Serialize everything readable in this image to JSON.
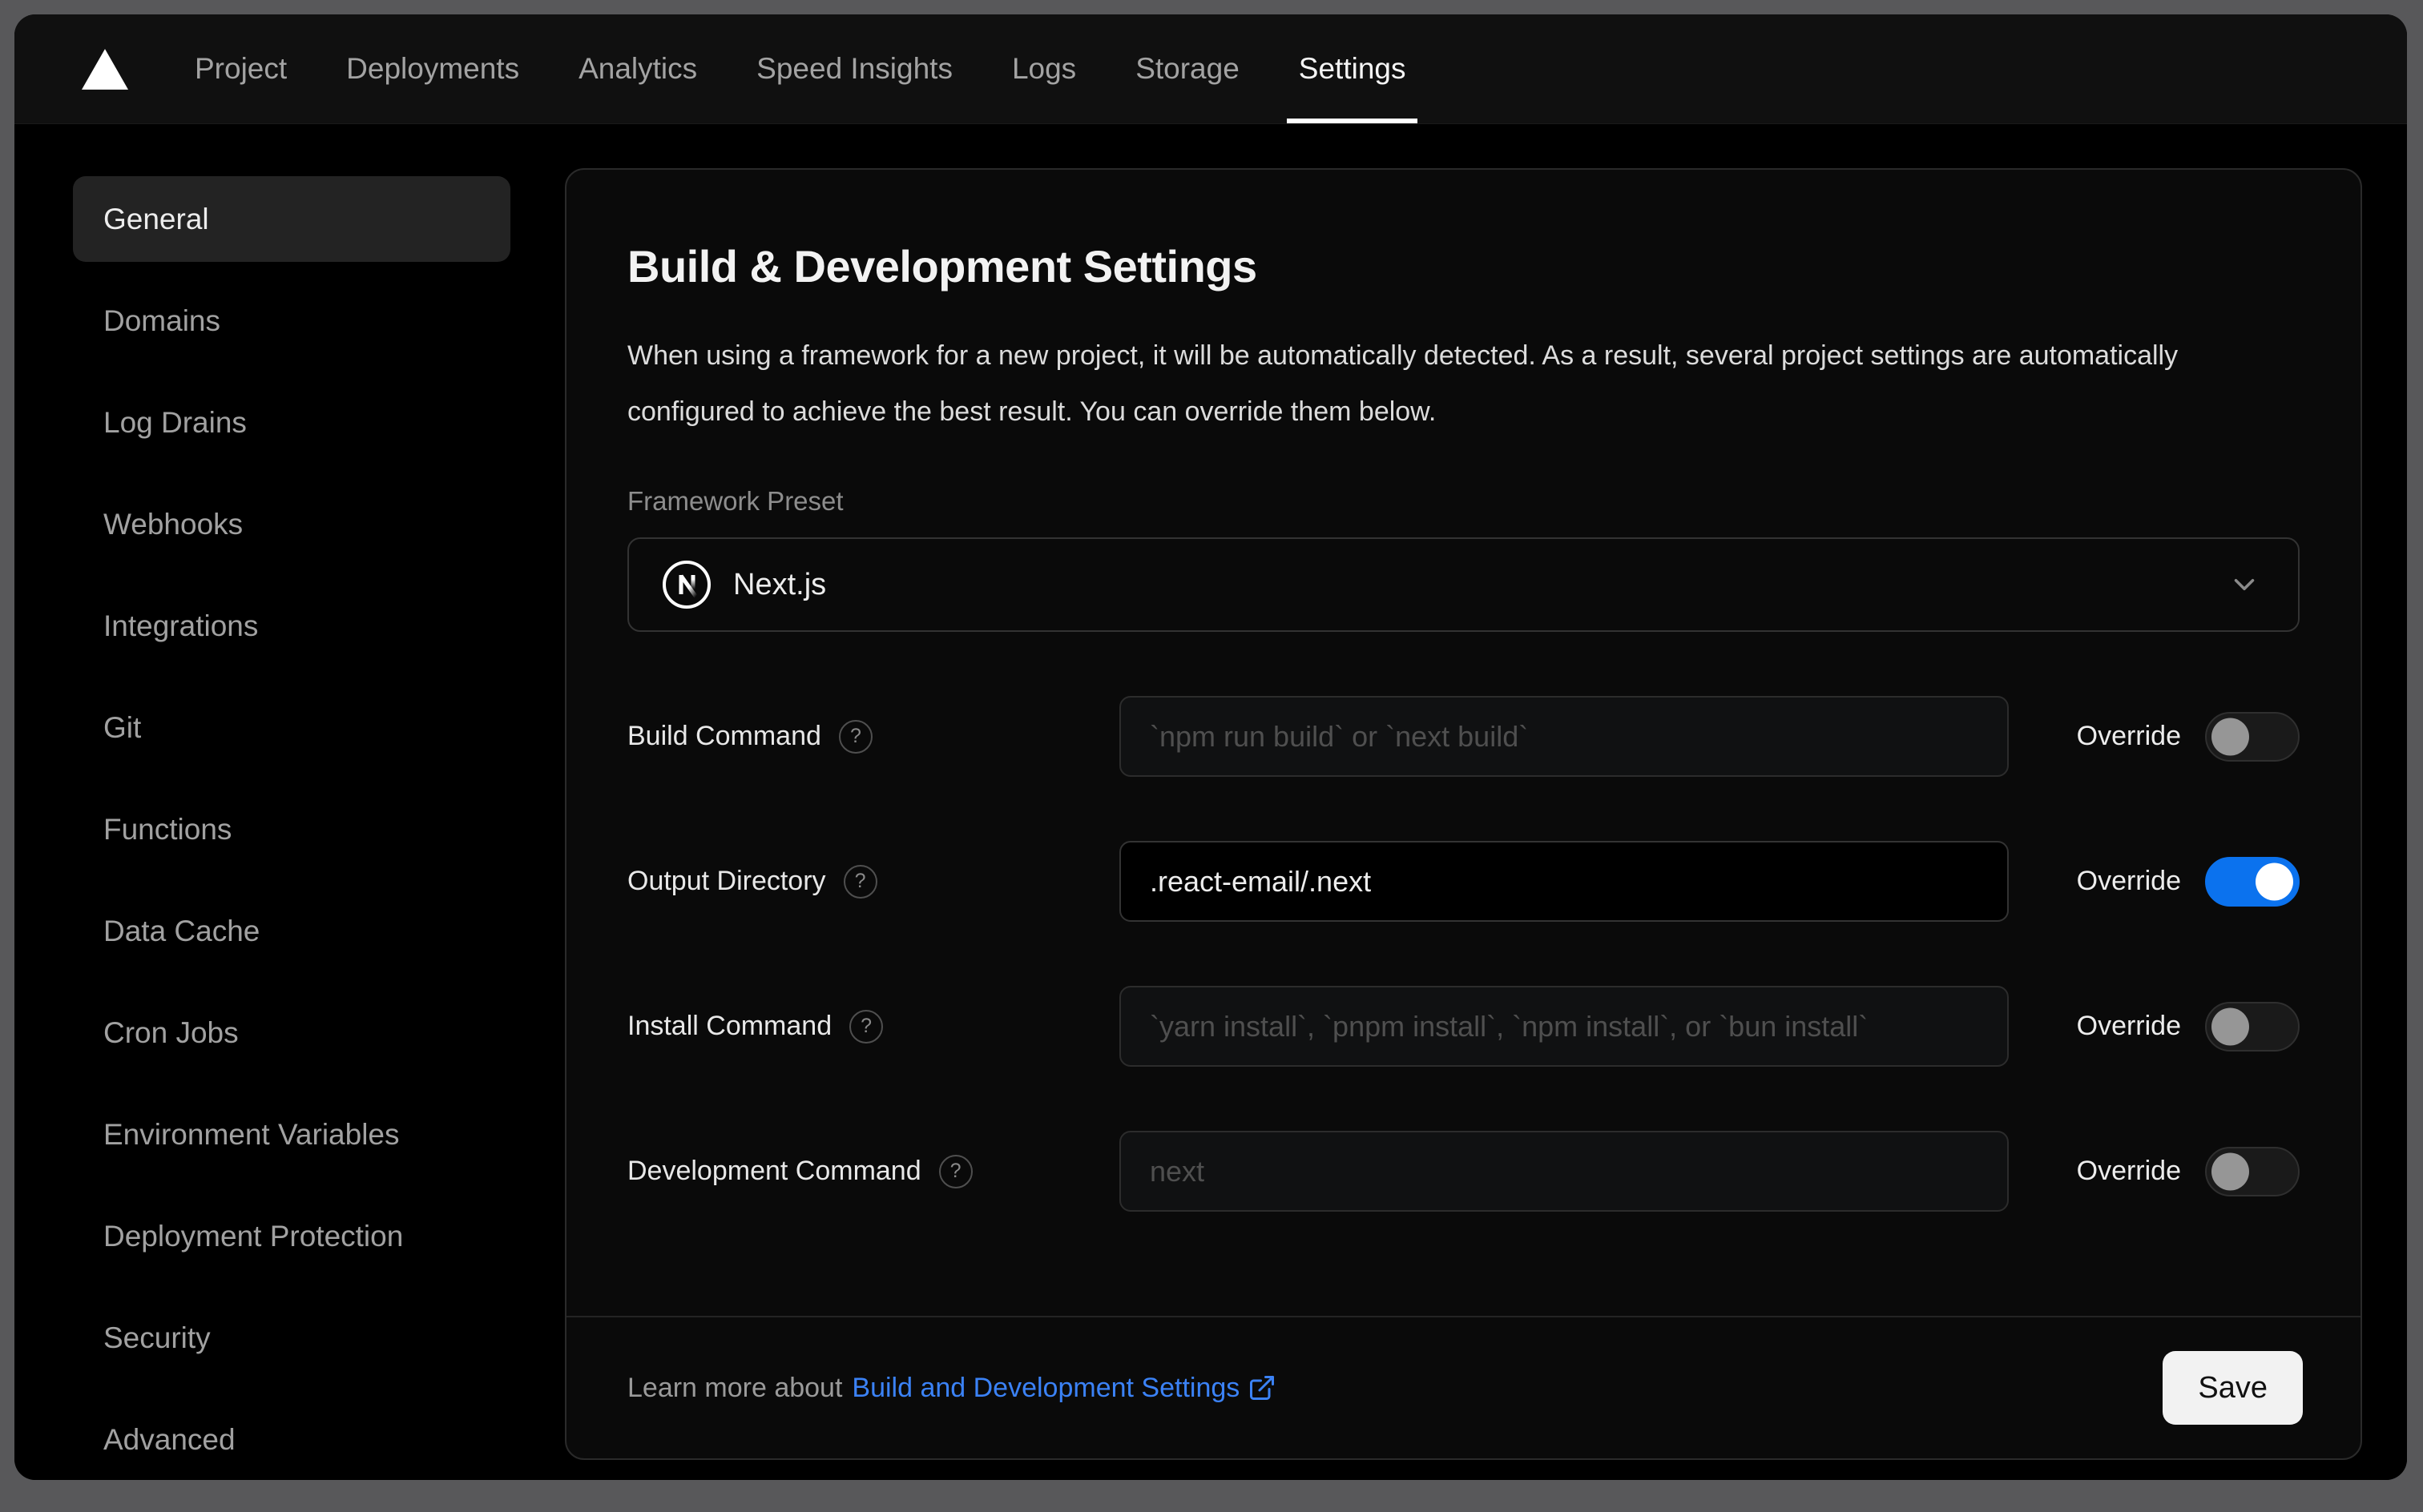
{
  "nav": {
    "tabs": [
      {
        "label": "Project"
      },
      {
        "label": "Deployments"
      },
      {
        "label": "Analytics"
      },
      {
        "label": "Speed Insights"
      },
      {
        "label": "Logs"
      },
      {
        "label": "Storage"
      },
      {
        "label": "Settings"
      }
    ],
    "active_tab": "Settings"
  },
  "sidebar": {
    "items": [
      "General",
      "Domains",
      "Log Drains",
      "Webhooks",
      "Integrations",
      "Git",
      "Functions",
      "Data Cache",
      "Cron Jobs",
      "Environment Variables",
      "Deployment Protection",
      "Security",
      "Advanced"
    ],
    "active_item": "General"
  },
  "main": {
    "title": "Build & Development Settings",
    "description": "When using a framework for a new project, it will be automatically detected. As a result, several project settings are automatically configured to achieve the best result. You can override them below.",
    "framework_label": "Framework Preset",
    "framework_value": "Next.js",
    "override_label": "Override",
    "rows": [
      {
        "label": "Build Command",
        "placeholder": "`npm run build` or `next build`",
        "override": false
      },
      {
        "label": "Output Directory",
        "value": ".react-email/.next",
        "override": true
      },
      {
        "label": "Install Command",
        "placeholder": "`yarn install`, `pnpm install`, `npm install`, or `bun install`",
        "override": false
      },
      {
        "label": "Development Command",
        "placeholder": "next",
        "override": false
      }
    ],
    "footer": {
      "prefix": "Learn more about",
      "link_label": "Build and Development Settings",
      "save_label": "Save"
    }
  },
  "icons": {
    "help": "?"
  },
  "colors": {
    "toggle_on_blue": "#0b72ee",
    "link_blue": "#3b82f6",
    "frame_gray": "#58585a",
    "card_bg": "#0a0a0a",
    "card_border": "#2a2a2a"
  }
}
